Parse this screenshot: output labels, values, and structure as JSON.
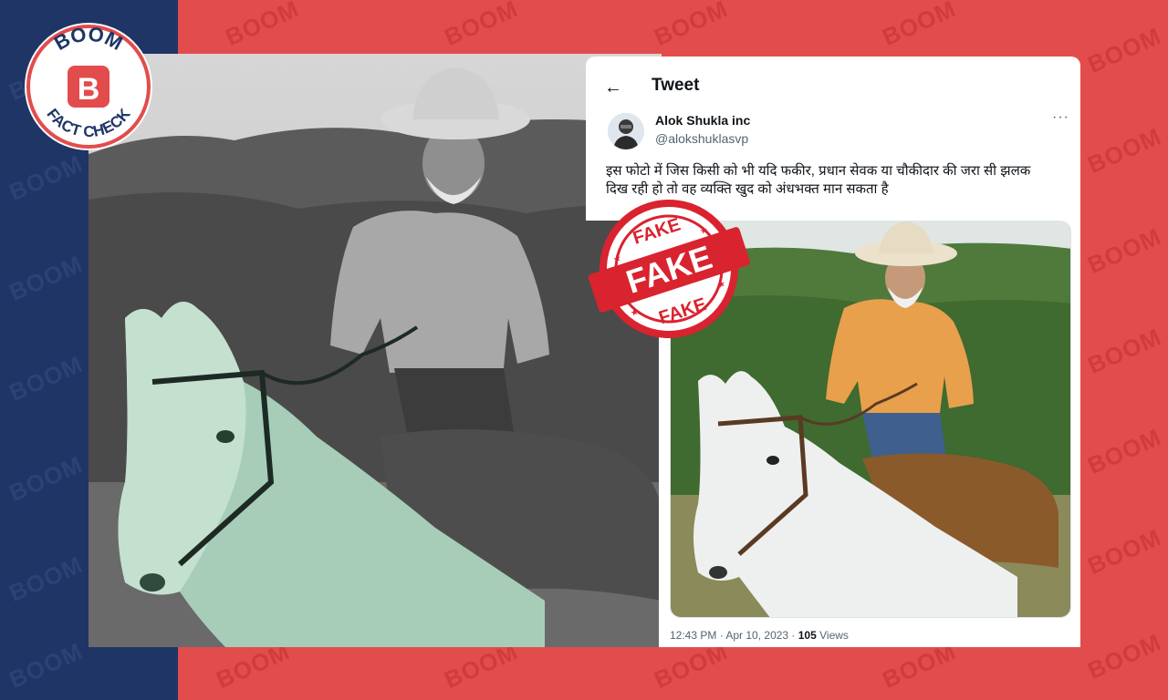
{
  "brand": {
    "watermark": "BOOM",
    "logo_top": "BOOM",
    "logo_letter": "B",
    "logo_bottom": "FACT CHECK",
    "colors": {
      "navy": "#1f3566",
      "red": "#e34c4c",
      "white": "#ffffff"
    }
  },
  "tweet": {
    "header_title": "Tweet",
    "back_icon": "arrow-left-icon",
    "author_name": "Alok Shukla inc",
    "author_handle": "@alokshuklasvp",
    "more_icon": "more-dots-icon",
    "text_line1": "इस फोटो में जिस किसी को भी यदि फकीर, प्रधान सेवक या चौकीदार की जरा सी झलक",
    "text_line2": "दिख रही हो तो वह व्यक्ति खुद को अंधभक्त मान सकता है",
    "time": "12:43 PM · Apr 10, 2023 · ",
    "views_count": "105",
    "views_label": " Views"
  },
  "stamp": {
    "top": "FAKE",
    "center": "FAKE",
    "bottom": "FAKE",
    "color": "#d9232f"
  }
}
